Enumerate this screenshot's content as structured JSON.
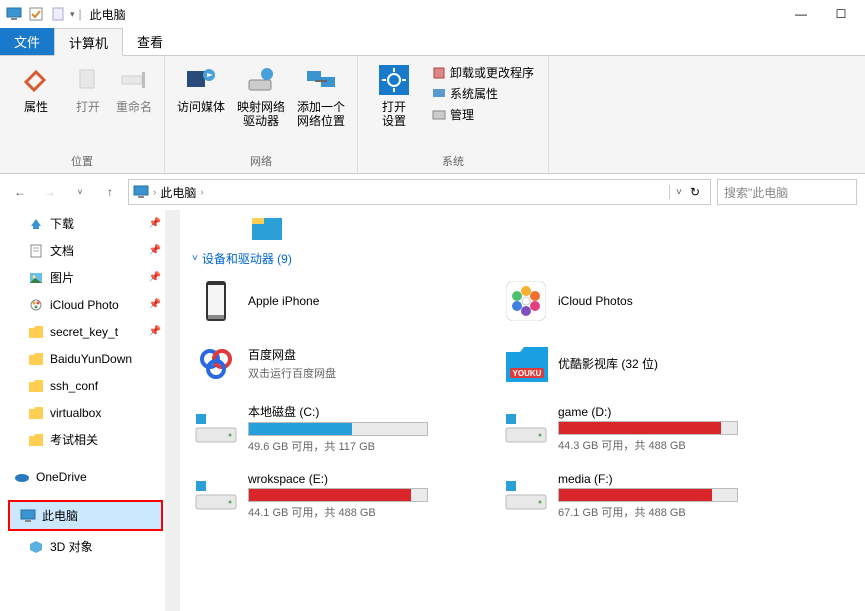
{
  "titlebar": {
    "title": "此电脑"
  },
  "tabs": {
    "file": "文件",
    "computer": "计算机",
    "view": "查看"
  },
  "ribbon": {
    "location": {
      "label": "位置",
      "properties": "属性",
      "open": "打开",
      "rename": "重命名"
    },
    "network": {
      "label": "网络",
      "media": "访问媒体",
      "mapdrive": "映射网络\n驱动器",
      "addloc": "添加一个\n网络位置"
    },
    "system": {
      "label": "系统",
      "settings": "打开\n设置",
      "uninstall": "卸载或更改程序",
      "sysprop": "系统属性",
      "manage": "管理"
    }
  },
  "nav": {
    "crumb": "此电脑",
    "search_placeholder": "搜索\"此电脑"
  },
  "sidebar": {
    "items": [
      {
        "label": "下载",
        "pin": true
      },
      {
        "label": "文档",
        "pin": true
      },
      {
        "label": "图片",
        "pin": true
      },
      {
        "label": "iCloud Photo",
        "pin": true
      },
      {
        "label": "secret_key_t",
        "pin": true
      },
      {
        "label": "BaiduYunDown",
        "pin": false
      },
      {
        "label": "ssh_conf",
        "pin": false
      },
      {
        "label": "virtualbox",
        "pin": false
      },
      {
        "label": "考试相关",
        "pin": false
      }
    ],
    "onedrive": "OneDrive",
    "thispc": "此电脑",
    "obj3d": "3D 对象"
  },
  "content": {
    "coloricon_row": true,
    "group_header": "设备和驱动器 (9)",
    "devices": [
      {
        "name": "Apple iPhone",
        "icon": "iphone",
        "sub": ""
      },
      {
        "name": "iCloud Photos",
        "icon": "photos",
        "sub": ""
      },
      {
        "name": "百度网盘",
        "icon": "baidu",
        "sub": "双击运行百度网盘"
      },
      {
        "name": "优酷影视库 (32 位)",
        "icon": "youku",
        "sub": ""
      }
    ],
    "drives": [
      {
        "name": "本地磁盘 (C:)",
        "free": "49.6 GB 可用，共 117 GB",
        "color": "blue",
        "pct": 58
      },
      {
        "name": "game (D:)",
        "free": "44.3 GB 可用，共 488 GB",
        "color": "red",
        "pct": 91
      },
      {
        "name": "wrokspace (E:)",
        "free": "44.1 GB 可用，共 488 GB",
        "color": "red",
        "pct": 91
      },
      {
        "name": "media (F:)",
        "free": "67.1 GB 可用，共 488 GB",
        "color": "red",
        "pct": 86
      }
    ]
  }
}
